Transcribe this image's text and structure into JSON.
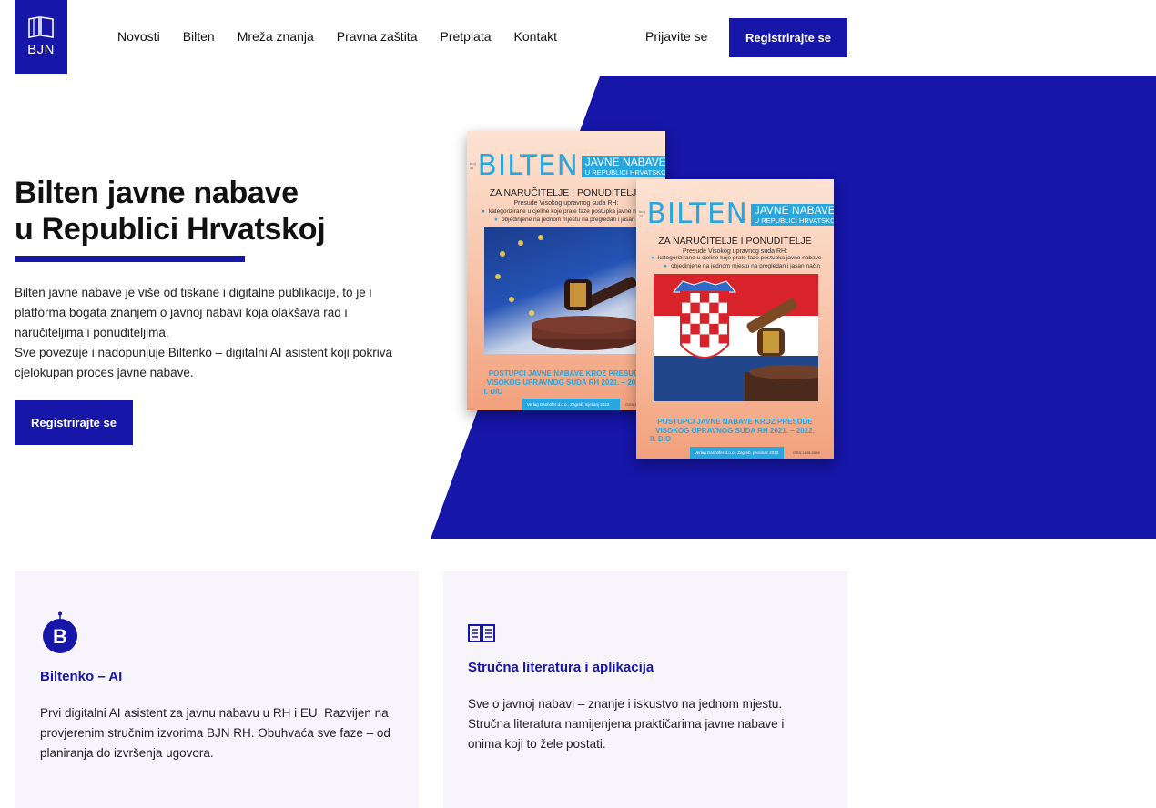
{
  "header": {
    "logo_text": "BJN",
    "nav": [
      "Novosti",
      "Bilten",
      "Mreža znanja",
      "Pravna zaštita",
      "Pretplata",
      "Kontakt"
    ],
    "login_label": "Prijavite se",
    "register_label": "Registrirajte se"
  },
  "hero": {
    "title_line1": "Bilten javne nabave",
    "title_line2": "u Republici Hrvatskoj",
    "paragraph1": "Bilten javne nabave je više od tiskane i digitalne publikacije, to je i platforma bogata znanjem o javnoj nabavi koja olakšava rad i naručiteljima i ponuditeljima.",
    "paragraph2": "Sve povezuje i nadopunjuje Biltenko – digitalni AI asistent koji pokriva cjelokupan proces javne nabave.",
    "register_label": "Registrirajte se",
    "accent_color": "#1616a8"
  },
  "books": [
    {
      "bilten": "BILTEN",
      "small_left": "broj 27",
      "javne_nabave": "JAVNE NABAVE",
      "rh": "U REPUBLICI HRVATSKOJ",
      "subtitle": "ZA NARUČITELJE I PONUDITELJE",
      "subtitle2": "Presude Visokog upravnog suda RH:",
      "bullet1": "kategorizirane u cjeline koje prate faze postupka javne nabave",
      "bullet2": "objedinjene na jednom mjestu na pregledan i jasan način",
      "foot_line1": "POSTUPCI JAVNE NABAVE KROZ PRESUDE",
      "foot_line2": "VISOKOG UPRAVNOG SUDA RH 2021. – 2022.",
      "foot_line3": "I. DIO",
      "publisher": "Verlag Dashöfer d.o.o., Zagreb, siječanj 2022.",
      "issn": "ISSN 1848-9598"
    },
    {
      "bilten": "BILTEN",
      "small_left": "broj 28",
      "javne_nabave": "JAVNE NABAVE",
      "rh": "U REPUBLICI HRVATSKOJ",
      "subtitle": "ZA NARUČITELJE I PONUDITELJE",
      "subtitle2": "Presude Visokog upravnog suda RH:",
      "bullet1": "kategorizirane u cjeline koje prate faze postupka javne nabave",
      "bullet2": "objedinjene na jednom mjestu na pregledan i jasan način",
      "foot_line1": "POSTUPCI JAVNE NABAVE KROZ PRESUDE",
      "foot_line2": "VISOKOG UPRAVNOG SUDA RH 2021. – 2022.",
      "foot_line3": "II. DIO",
      "publisher": "Verlag Dashöfer d.o.o., Zagreb, prosinac 2022.",
      "issn": "ISSN 1848-9598"
    }
  ],
  "cards": [
    {
      "icon": "robot-b-icon",
      "title": "Biltenko – AI",
      "text": "Prvi digitalni AI asistent za javnu nabavu u RH i EU. Razvijen na provjerenim stručnim izvorima BJN RH. Obuhvaća sve faze – od planiranja do izvršenja ugovora."
    },
    {
      "icon": "open-book-icon",
      "title": "Stručna literatura i aplikacija",
      "text": "Sve o javnoj nabavi – znanje i iskustvo na jednom mjestu. Stručna literatura namijenjena praktičarima javne nabave i onima koji to žele postati."
    }
  ]
}
